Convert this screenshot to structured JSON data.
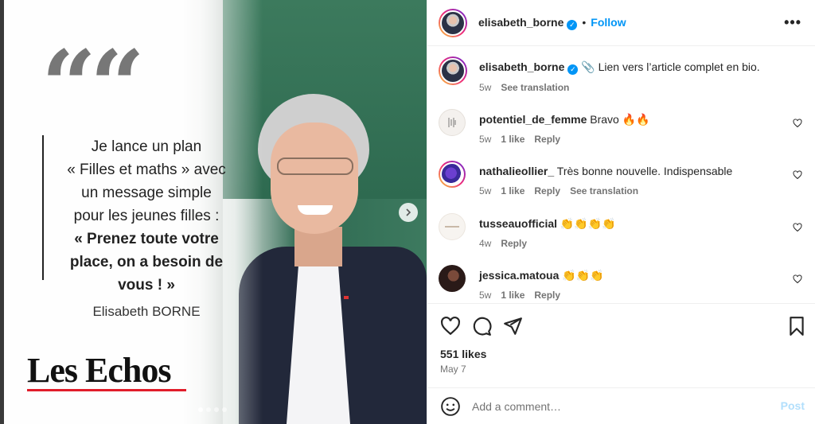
{
  "post": {
    "quote_lines": [
      "Je lance un plan",
      "« Filles et maths » avec",
      "un message simple",
      "pour les jeunes filles :"
    ],
    "quote_bold_lines": [
      "« Prenez toute votre",
      "place, on a besoin de",
      "vous ! »"
    ],
    "quote_mark": "“",
    "author": "Elisabeth BORNE",
    "brand": "Les Echos",
    "slide_count": 4,
    "active_slide": 1,
    "colors": {
      "brand_underline": "#e11d2b",
      "board_green": "#3c7a5d"
    }
  },
  "header": {
    "username": "elisabeth_borne",
    "separator": "•",
    "follow_label": "Follow",
    "more_icon": "more-horizontal-icon"
  },
  "caption": {
    "username": "elisabeth_borne",
    "emoji": "📎",
    "text": "Lien vers l’article complet en bio.",
    "time": "5w",
    "translate": "See translation"
  },
  "comments": [
    {
      "username": "potentiel_de_femme",
      "text": "Bravo 🔥🔥",
      "time": "5w",
      "likes": "1 like",
      "reply": "Reply",
      "translate": ""
    },
    {
      "username": "nathalieollier_",
      "text": "Très bonne nouvelle. Indispensable",
      "time": "5w",
      "likes": "1 like",
      "reply": "Reply",
      "translate": "See translation"
    },
    {
      "username": "tusseauofficial",
      "text": "👏👏👏👏",
      "time": "4w",
      "likes": "",
      "reply": "Reply",
      "translate": ""
    },
    {
      "username": "jessica.matoua",
      "text": "👏👏👏",
      "time": "5w",
      "likes": "1 like",
      "reply": "Reply",
      "translate": ""
    }
  ],
  "actions": {
    "likes": "551 likes",
    "date": "May 7"
  },
  "add_comment": {
    "placeholder": "Add a comment…",
    "post_label": "Post"
  }
}
